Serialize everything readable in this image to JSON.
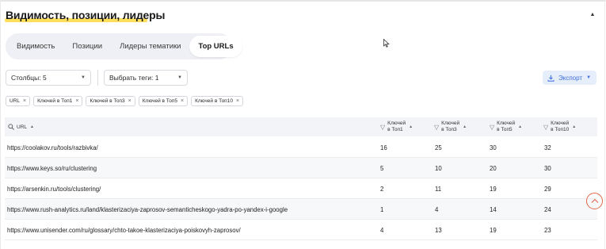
{
  "page": {
    "title": "Видимость, позиции, лидеры"
  },
  "tabs": [
    "Видимость",
    "Позиции",
    "Лидеры тематики",
    "Top URLs"
  ],
  "active_tab": "Top URLs",
  "filters": {
    "columns_label": "Столбцы: 5",
    "tags_label": "Выбрать теги: 1",
    "export_label": "Экспорт"
  },
  "chips": [
    "URL",
    "Ключей в Топ1",
    "Ключей в Топ3",
    "Ключей в Топ5",
    "Ключей в Топ10"
  ],
  "table": {
    "headers": {
      "url": "URL",
      "top1_l1": "Ключей",
      "top1_l2": "в Топ1",
      "top3_l1": "Ключей",
      "top3_l2": "в Топ3",
      "top5_l1": "Ключей",
      "top5_l2": "в Топ5",
      "top10_l1": "Ключей",
      "top10_l2": "в Топ10"
    },
    "rows": [
      {
        "url": "https://coolakov.ru/tools/razbivka/",
        "top1": "16",
        "top3": "25",
        "top5": "30",
        "top10": "32"
      },
      {
        "url": "https://www.keys.so/ru/clustering",
        "top1": "5",
        "top3": "10",
        "top5": "20",
        "top10": "30"
      },
      {
        "url": "https://arsenkin.ru/tools/clustering/",
        "top1": "2",
        "top3": "11",
        "top5": "19",
        "top10": "29"
      },
      {
        "url": "https://www.rush-analytics.ru/land/klasterizaciya-zaprosov-semanticheskogo-yadra-po-yandex-i-google",
        "top1": "1",
        "top3": "4",
        "top5": "14",
        "top10": "24"
      },
      {
        "url": "https://www.unisender.com/ru/glossary/chto-takoe-klasterizaciya-poiskovyh-zaprosov/",
        "top1": "4",
        "top3": "13",
        "top5": "19",
        "top10": "23"
      }
    ]
  },
  "colors": {
    "accent": "#3d6fd8",
    "highlight": "#ffdb4d",
    "scroll_button": "#e2664b"
  },
  "icons": [
    "chevron-up-icon",
    "chevron-down-icon",
    "download-icon",
    "search-icon",
    "filter-icon",
    "sort-icon",
    "close-icon",
    "arrow-up-icon"
  ]
}
